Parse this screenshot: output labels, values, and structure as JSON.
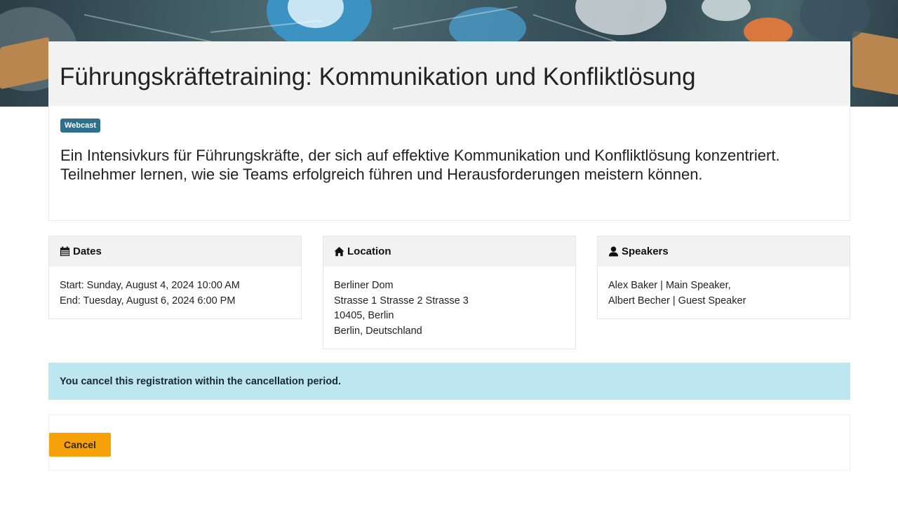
{
  "event": {
    "title": "Führungskräftetraining: Kommunikation und Konfliktlösung",
    "badge": "Webcast",
    "description": "Ein Intensivkurs für Führungskräfte, der sich auf effektive Kommunikation und Konfliktlösung konzentriert. Teilnehmer lernen, wie sie Teams erfolgreich führen und Herausforderungen meistern können."
  },
  "dates": {
    "header": "Dates",
    "icon": "calendar-icon",
    "start": "Start: Sunday, August 4, 2024 10:00 AM",
    "end": "End: Tuesday, August 6, 2024 6:00 PM"
  },
  "location": {
    "header": "Location",
    "icon": "home-icon",
    "lines": [
      "Berliner Dom",
      "Strasse 1 Strasse 2 Strasse 3",
      "10405, Berlin",
      "Berlin, Deutschland"
    ]
  },
  "speakers": {
    "header": "Speakers",
    "icon": "user-icon",
    "lines": [
      "Alex Baker | Main Speaker,",
      "Albert Becher | Guest Speaker"
    ]
  },
  "alert": {
    "text": "You cancel this registration within the cancellation period."
  },
  "actions": {
    "cancel_label": "Cancel"
  },
  "colors": {
    "badge": "#2e6f8e",
    "alert_bg": "#bde6f1",
    "cancel_button": "#f6a00a"
  }
}
